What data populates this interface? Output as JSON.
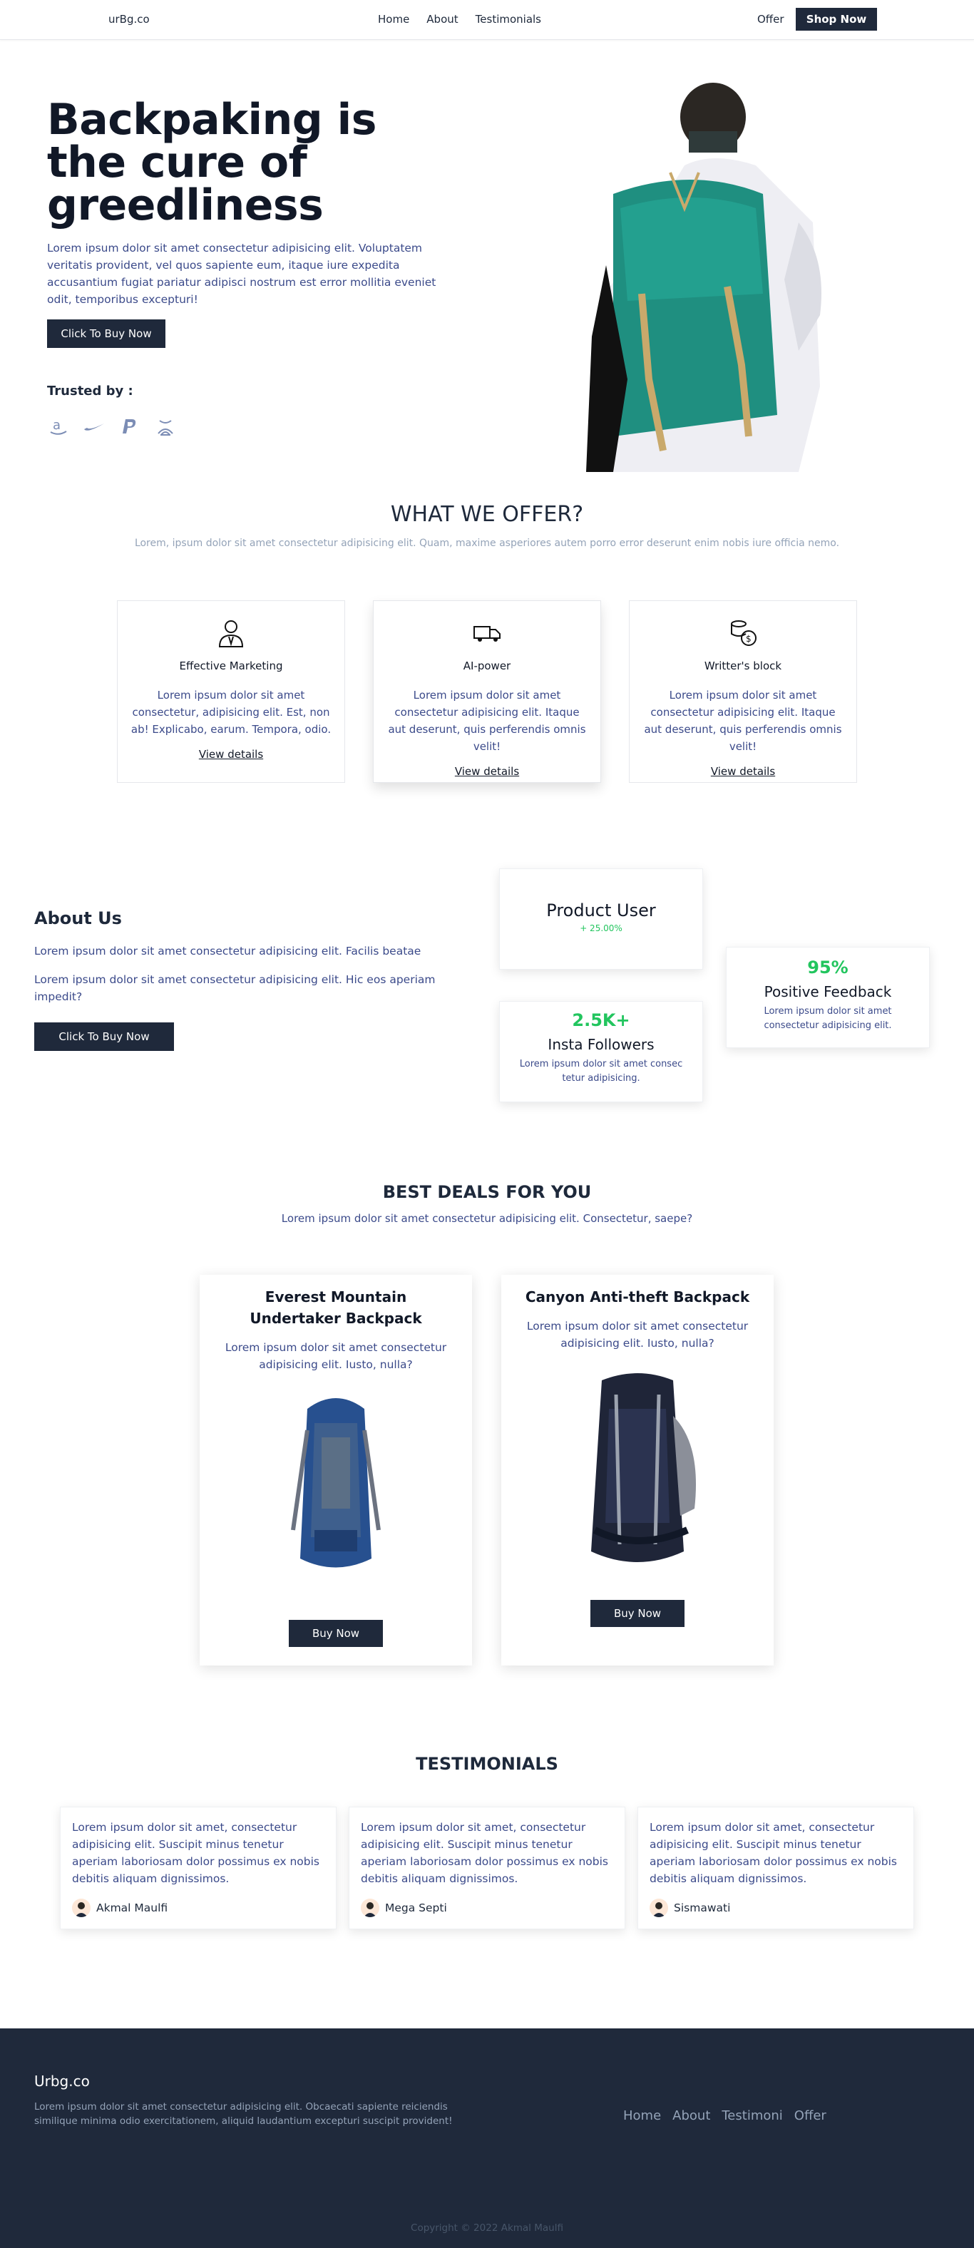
{
  "nav": {
    "logo": "urBg.co",
    "links": [
      "Home",
      "About",
      "Testimonials"
    ],
    "offer": "Offer",
    "shop_now": "Shop Now"
  },
  "hero": {
    "title": "Backpaking is the cure of greedliness",
    "description": "Lorem ipsum dolor sit amet consectetur adipisicing elit. Voluptatem veritatis provident, vel quos sapiente eum, itaque iure expedita accusantium fugiat pariatur adipisci nostrum est error mollitia eveniet odit, temporibus excepturi!",
    "button": "Click To Buy Now",
    "trusted_label": "Trusted by :",
    "brand_icons": [
      "amazon-icon",
      "nike-icon",
      "paypal-icon",
      "xbox-icon"
    ]
  },
  "offer": {
    "title": "WHAT WE OFFER?",
    "subtitle": "Lorem, ipsum dolor sit amet consectetur adipisicing elit. Quam, maxime asperiores autem porro error deserunt enim nobis iure officia nemo.",
    "cards": [
      {
        "icon": "marketer-icon",
        "title": "Effective Marketing",
        "text": "Lorem ipsum dolor sit amet consectetur, adipisicing elit. Est, non ab! Explicabo, earum. Tempora, odio.",
        "link": "View details"
      },
      {
        "icon": "truck-icon",
        "title": "AI-power",
        "text": "Lorem ipsum dolor sit amet consectetur adipisicing elit. Itaque aut deserunt, quis perferendis omnis velit!",
        "link": "View details"
      },
      {
        "icon": "coins-icon",
        "title": "Writter's block",
        "text": "Lorem ipsum dolor sit amet consectetur adipisicing elit. Itaque aut deserunt, quis perferendis omnis velit!",
        "link": "View details"
      }
    ]
  },
  "about": {
    "title": "About Us",
    "p1": "Lorem ipsum dolor sit amet consectetur adipisicing elit. Facilis beatae",
    "p2": "Lorem ipsum dolor sit amet consectetur adipisicing elit. Hic eos aperiam impedit?",
    "button": "Click To Buy Now",
    "stats": {
      "product_user": {
        "label": "Product User",
        "change": "+ 25.00%"
      },
      "followers": {
        "value": "2.5K+",
        "label": "Insta Followers",
        "text": "Lorem ipsum dolor sit amet consec tetur adipisicing."
      },
      "feedback": {
        "value": "95%",
        "label": "Positive Feedback",
        "text": "Lorem ipsum dolor sit amet consectetur adipisicing elit."
      }
    }
  },
  "deals": {
    "title": "BEST DEALS FOR YOU",
    "subtitle": "Lorem ipsum dolor sit amet consectetur adipisicing elit. Consectetur, saepe?",
    "items": [
      {
        "name": "Everest Mountain Undertaker Backpack",
        "text": "Lorem ipsum dolor sit amet consectetur adipisicing elit. Iusto, nulla?",
        "button": "Buy Now"
      },
      {
        "name": "Canyon Anti-theft Backpack",
        "text": "Lorem ipsum dolor sit amet consectetur adipisicing elit. Iusto, nulla?",
        "button": "Buy Now"
      }
    ]
  },
  "testimonials": {
    "title": "TESTIMONIALS",
    "items": [
      {
        "text": "Lorem ipsum dolor sit amet, consectetur adipisicing elit. Suscipit minus tenetur aperiam laboriosam dolor possimus ex nobis debitis aliquam dignissimos.",
        "name": "Akmal Maulfi"
      },
      {
        "text": "Lorem ipsum dolor sit amet, consectetur adipisicing elit. Suscipit minus tenetur aperiam laboriosam dolor possimus ex nobis debitis aliquam dignissimos.",
        "name": "Mega Septi"
      },
      {
        "text": "Lorem ipsum dolor sit amet, consectetur adipisicing elit. Suscipit minus tenetur aperiam laboriosam dolor possimus ex nobis debitis aliquam dignissimos.",
        "name": "Sismawati"
      }
    ]
  },
  "footer": {
    "logo": "Urbg.co",
    "description": "Lorem ipsum dolor sit amet consectetur adipisicing elit. Obcaecati sapiente reiciendis similique minima odio exercitationem, aliquid laudantium excepturi suscipit provident!",
    "links": [
      "Home",
      "About",
      "Testimoni",
      "Offer"
    ],
    "copyright": "Copyright © 2022 Akmal Maulfi"
  },
  "colors": {
    "navy": "#1f293b",
    "text_blue": "#3b4a8a",
    "green": "#22c55e",
    "muted": "#94a3b8"
  }
}
